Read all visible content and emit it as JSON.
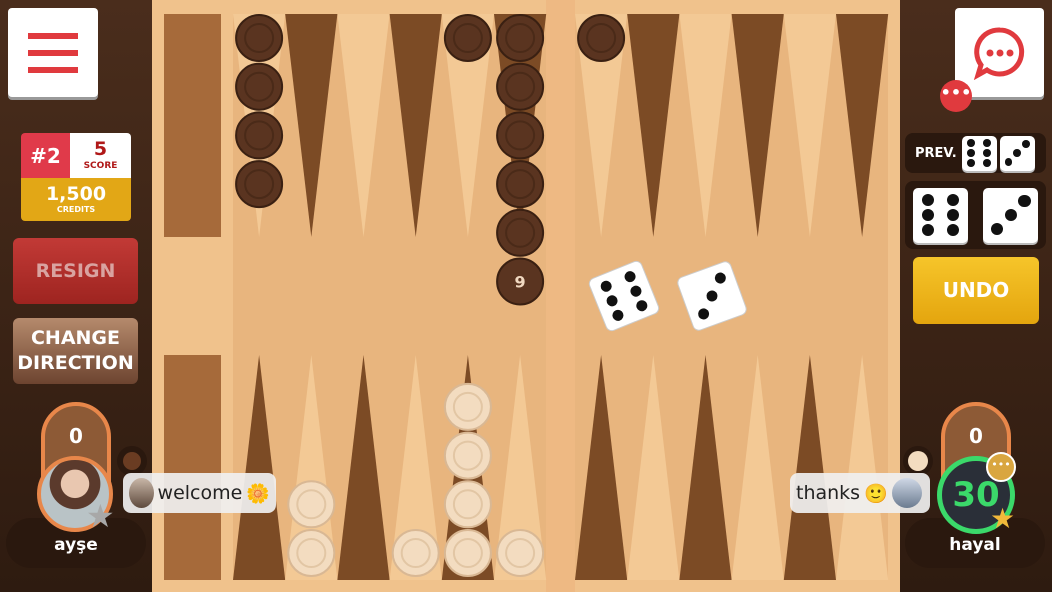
{
  "colors": {
    "board_wood": "#e8b57e",
    "dark_point": "#7c4b25",
    "light_point": "#f3c995",
    "dark_checker": "#5a3420",
    "light_checker": "#f3dcc0",
    "accent_red": "#e03a3e",
    "gold": "#e2a716"
  },
  "menu": {
    "icon": "hamburger-menu-icon"
  },
  "chat_button": {
    "icon": "chat-bubble-icon",
    "badge_icon": "more-dots-icon"
  },
  "score_card": {
    "rank": "#2",
    "score": "5",
    "score_label": "SCORE",
    "credits": "1,500",
    "credits_label": "CREDITS"
  },
  "buttons": {
    "resign": "RESIGN",
    "change_direction_1": "CHANGE",
    "change_direction_2": "DIRECTION",
    "undo": "UNDO"
  },
  "previous_dice": {
    "label": "PREV.",
    "values": [
      6,
      3
    ]
  },
  "current_dice": [
    6,
    3
  ],
  "board_dice": [
    6,
    3
  ],
  "player_left": {
    "name": "ayşe",
    "borne_off": "0",
    "message": "welcome",
    "emoji": "🌼"
  },
  "player_right": {
    "name": "hayal",
    "borne_off": "0",
    "timer": "30",
    "message": "thanks",
    "emoji": "🙂"
  },
  "board": {
    "top_left": [
      {
        "color": "dark",
        "count": 4
      },
      {
        "color": null,
        "count": 0
      },
      {
        "color": null,
        "count": 0
      },
      {
        "color": null,
        "count": 0
      },
      {
        "color": "dark",
        "count": 1
      },
      {
        "color": "dark",
        "count": 9,
        "label": "9"
      }
    ],
    "top_right": [
      {
        "color": "dark",
        "count": 1
      },
      {
        "color": null,
        "count": 0
      },
      {
        "color": null,
        "count": 0
      },
      {
        "color": null,
        "count": 0
      },
      {
        "color": null,
        "count": 0
      },
      {
        "color": null,
        "count": 0
      }
    ],
    "bottom_left": [
      {
        "color": null,
        "count": 0
      },
      {
        "color": "light",
        "count": 2
      },
      {
        "color": null,
        "count": 0
      },
      {
        "color": "light",
        "count": 1
      },
      {
        "color": "light",
        "count": 4
      },
      {
        "color": "light",
        "count": 1
      }
    ],
    "bottom_right": [
      {
        "color": null,
        "count": 0
      },
      {
        "color": null,
        "count": 0
      },
      {
        "color": null,
        "count": 0
      },
      {
        "color": null,
        "count": 0
      },
      {
        "color": null,
        "count": 0
      },
      {
        "color": null,
        "count": 0
      }
    ]
  }
}
